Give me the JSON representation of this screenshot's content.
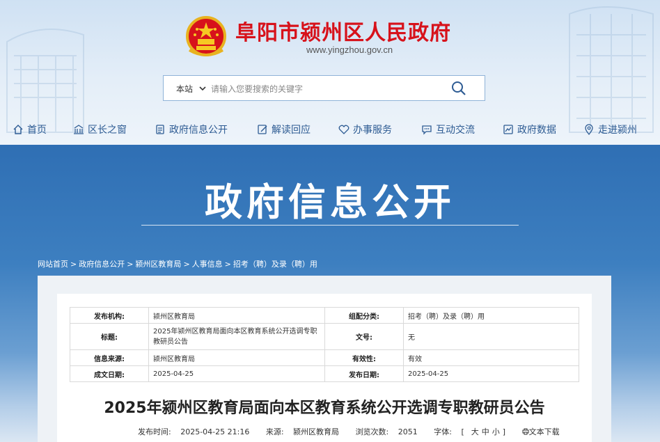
{
  "site": {
    "title": "阜阳市颍州区人民政府",
    "url": "www.yingzhou.gov.cn",
    "brand_red": "#d7121b",
    "nav_blue": "#2d5b93"
  },
  "search": {
    "scope": "本站",
    "placeholder": "请输入您要搜索的关键字"
  },
  "nav": {
    "items": [
      {
        "label": "首页",
        "icon": "home-icon"
      },
      {
        "label": "区长之窗",
        "icon": "building-icon"
      },
      {
        "label": "政府信息公开",
        "icon": "document-icon"
      },
      {
        "label": "解读回应",
        "icon": "edit-icon"
      },
      {
        "label": "办事服务",
        "icon": "service-icon"
      },
      {
        "label": "互动交流",
        "icon": "chat-icon"
      },
      {
        "label": "政府数据",
        "icon": "chart-icon"
      },
      {
        "label": "走进颍州",
        "icon": "location-icon"
      }
    ]
  },
  "banner": {
    "title": "政府信息公开"
  },
  "breadcrumb": {
    "items": [
      "网站首页",
      "政府信息公开",
      "颍州区教育局",
      "人事信息",
      "招考（聘）及录（聘）用"
    ],
    "separator": ">"
  },
  "meta": {
    "publisher_label": "发布机构:",
    "publisher": "颍州区教育局",
    "category_label": "组配分类:",
    "category": "招考（聘）及录（聘）用",
    "title_label": "标题:",
    "title": "2025年颍州区教育局面向本区教育系统公开选调专职教研员公告",
    "docno_label": "文号:",
    "docno": "无",
    "source_label": "信息来源:",
    "source": "颍州区教育局",
    "validity_label": "有效性:",
    "validity": "有效",
    "created_label": "成文日期:",
    "created": "2025-04-25",
    "published_label": "发布日期:",
    "published": "2025-04-25"
  },
  "article": {
    "title": "2025年颍州区教育局面向本区教育系统公开选调专职教研员公告",
    "time_label": "发布时间:",
    "time": "2025-04-25 21:16",
    "source_label": "来源:",
    "source": "颍州区教育局",
    "views_label": "浏览次数:",
    "views": "2051",
    "font_label": "字体:",
    "font_open": "[",
    "font_large": "大",
    "font_medium": "中",
    "font_small": "小",
    "font_close": "]",
    "download": "文本下载"
  }
}
